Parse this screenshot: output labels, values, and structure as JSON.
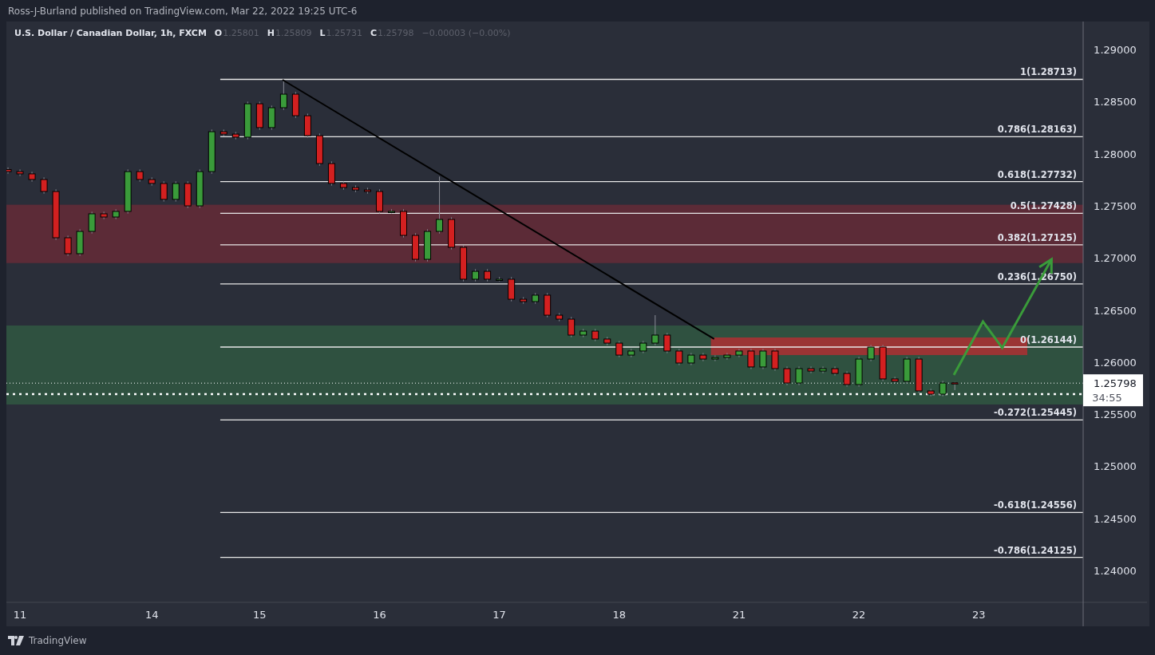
{
  "header": {
    "publisher_line": "Ross-J-Burland published on TradingView.com, Mar 22, 2022 19:25 UTC-6"
  },
  "legend": {
    "symbol": "U.S. Dollar / Canadian Dollar, 1h, FXCM",
    "ohlc": [
      {
        "key": "O",
        "value": "1.25801"
      },
      {
        "key": "H",
        "value": "1.25809"
      },
      {
        "key": "L",
        "value": "1.25731"
      },
      {
        "key": "C",
        "value": "1.25798"
      }
    ],
    "change": "−0.00003 (−0.00%)"
  },
  "chart": {
    "chart_data": {
      "type": "candlestick",
      "ylim": [
        1.23694,
        1.29268
      ],
      "categories": [
        null,
        "11",
        null,
        null,
        null,
        null,
        null,
        null,
        null,
        null,
        null,
        null,
        "14",
        null,
        null,
        null,
        null,
        null,
        null,
        null,
        null,
        "15",
        null,
        null,
        null,
        null,
        null,
        null,
        null,
        null,
        null,
        "16",
        null,
        null,
        null,
        null,
        null,
        null,
        null,
        null,
        null,
        "17",
        null,
        null,
        null,
        null,
        null,
        null,
        null,
        null,
        null,
        "18",
        null,
        null,
        null,
        null,
        null,
        null,
        null,
        null,
        null,
        "21",
        null,
        null,
        null,
        null,
        null,
        null,
        null,
        null,
        null,
        "22",
        null,
        null,
        null,
        null,
        null,
        null,
        null,
        null,
        null,
        "23",
        null,
        null,
        null,
        null,
        null,
        null,
        null,
        null,
        null
      ],
      "ohlc": [
        [
          1.27848,
          1.27868,
          1.27808,
          1.27828
        ],
        [
          1.27828,
          1.27848,
          1.27786,
          1.27806
        ],
        [
          1.27806,
          1.27826,
          1.27732,
          1.27752
        ],
        [
          1.27752,
          1.27772,
          1.27617,
          1.27637
        ],
        [
          1.27637,
          1.27657,
          1.27173,
          1.27193
        ],
        [
          1.27193,
          1.27213,
          1.2702,
          1.2704
        ],
        [
          1.2704,
          1.27274,
          1.2702,
          1.27254
        ],
        [
          1.27254,
          1.27443,
          1.27234,
          1.27423
        ],
        [
          1.27423,
          1.27443,
          1.27372,
          1.27392
        ],
        [
          1.27392,
          1.27466,
          1.27372,
          1.27446
        ],
        [
          1.27446,
          1.27848,
          1.27426,
          1.27828
        ],
        [
          1.27828,
          1.27848,
          1.27732,
          1.27752
        ],
        [
          1.27752,
          1.27772,
          1.27694,
          1.27714
        ],
        [
          1.27714,
          1.27734,
          1.27541,
          1.27561
        ],
        [
          1.27561,
          1.27734,
          1.27541,
          1.27714
        ],
        [
          1.27714,
          1.27734,
          1.27479,
          1.27499
        ],
        [
          1.27499,
          1.27848,
          1.27479,
          1.27828
        ],
        [
          1.27828,
          1.28231,
          1.27808,
          1.28211
        ],
        [
          1.28211,
          1.28231,
          1.28168,
          1.28188
        ],
        [
          1.28188,
          1.28208,
          1.28138,
          1.28158
        ],
        [
          1.28158,
          1.28499,
          1.28138,
          1.28479
        ],
        [
          1.28479,
          1.28499,
          1.2823,
          1.2825
        ],
        [
          1.2825,
          1.28461,
          1.2823,
          1.28441
        ],
        [
          1.28441,
          1.28713,
          1.28421,
          1.28571
        ],
        [
          1.28571,
          1.28591,
          1.28344,
          1.28364
        ],
        [
          1.28364,
          1.28384,
          1.28153,
          1.28173
        ],
        [
          1.28173,
          1.28193,
          1.27885,
          1.27905
        ],
        [
          1.27905,
          1.27925,
          1.27694,
          1.27714
        ],
        [
          1.27714,
          1.27734,
          1.27655,
          1.27675
        ],
        [
          1.27675,
          1.27695,
          1.27632,
          1.27652
        ],
        [
          1.27652,
          1.27672,
          1.27617,
          1.27637
        ],
        [
          1.27637,
          1.27657,
          1.27426,
          1.27446
        ],
        [
          1.27446,
          1.27466,
          1.27426,
          1.27446
        ],
        [
          1.27446,
          1.27466,
          1.27196,
          1.27216
        ],
        [
          1.27216,
          1.27236,
          1.26966,
          1.26986
        ],
        [
          1.26986,
          1.27274,
          1.26966,
          1.27254
        ],
        [
          1.27254,
          1.2778,
          1.27234,
          1.27369
        ],
        [
          1.27369,
          1.27389,
          1.27081,
          1.27101
        ],
        [
          1.27101,
          1.27121,
          1.26775,
          1.26795
        ],
        [
          1.26795,
          1.26891,
          1.26775,
          1.26871
        ],
        [
          1.26871,
          1.26891,
          1.26775,
          1.26795
        ],
        [
          1.26795,
          1.26815,
          1.26775,
          1.26795
        ],
        [
          1.26795,
          1.26815,
          1.26583,
          1.26603
        ],
        [
          1.26603,
          1.26623,
          1.2656,
          1.2658
        ],
        [
          1.2658,
          1.26662,
          1.2656,
          1.26642
        ],
        [
          1.26642,
          1.26662,
          1.2643,
          1.2645
        ],
        [
          1.2645,
          1.2647,
          1.26392,
          1.26412
        ],
        [
          1.26412,
          1.26432,
          1.26239,
          1.26259
        ],
        [
          1.26259,
          1.26317,
          1.26239,
          1.26297
        ],
        [
          1.26297,
          1.26317,
          1.26201,
          1.26221
        ],
        [
          1.26221,
          1.26241,
          1.26162,
          1.26182
        ],
        [
          1.26182,
          1.26202,
          1.26047,
          1.26067
        ],
        [
          1.26067,
          1.26126,
          1.26047,
          1.26106
        ],
        [
          1.26106,
          1.26202,
          1.26086,
          1.26182
        ],
        [
          1.26182,
          1.2645,
          1.26162,
          1.26259
        ],
        [
          1.26259,
          1.26279,
          1.26086,
          1.26106
        ],
        [
          1.26106,
          1.26126,
          1.25971,
          1.25991
        ],
        [
          1.25991,
          1.26087,
          1.25971,
          1.26067
        ],
        [
          1.26067,
          1.26087,
          1.26009,
          1.26029
        ],
        [
          1.26029,
          1.26064,
          1.26009,
          1.26044
        ],
        [
          1.26044,
          1.26087,
          1.26024,
          1.26067
        ],
        [
          1.26067,
          1.26126,
          1.26047,
          1.26106
        ],
        [
          1.26106,
          1.26126,
          1.25933,
          1.25953
        ],
        [
          1.25953,
          1.26126,
          1.25933,
          1.26106
        ],
        [
          1.26106,
          1.26126,
          1.25917,
          1.25937
        ],
        [
          1.25937,
          1.25957,
          1.25779,
          1.25799
        ],
        [
          1.25799,
          1.25957,
          1.25779,
          1.25937
        ],
        [
          1.25937,
          1.25957,
          1.25894,
          1.25914
        ],
        [
          1.25914,
          1.25957,
          1.25894,
          1.25937
        ],
        [
          1.25937,
          1.25957,
          1.25871,
          1.25891
        ],
        [
          1.25891,
          1.25911,
          1.25764,
          1.25784
        ],
        [
          1.25784,
          1.26049,
          1.25764,
          1.26029
        ],
        [
          1.26029,
          1.26164,
          1.26009,
          1.26144
        ],
        [
          1.26144,
          1.26164,
          1.25818,
          1.25838
        ],
        [
          1.25838,
          1.25858,
          1.25795,
          1.25815
        ],
        [
          1.25815,
          1.26049,
          1.25795,
          1.26029
        ],
        [
          1.26029,
          1.26049,
          1.25703,
          1.25723
        ],
        [
          1.25723,
          1.25743,
          1.25672,
          1.25692
        ],
        [
          1.25692,
          1.25819,
          1.25672,
          1.25799
        ],
        [
          1.25801,
          1.25809,
          1.25731,
          1.25798
        ],
        null,
        null,
        null,
        null,
        null,
        null,
        null,
        null,
        null,
        null,
        null
      ],
      "yticks": [
        {
          "value": 1.29,
          "label": "1.29000"
        },
        {
          "value": 1.285,
          "label": "1.28500"
        },
        {
          "value": 1.28,
          "label": "1.28000"
        },
        {
          "value": 1.275,
          "label": "1.27500"
        },
        {
          "value": 1.27,
          "label": "1.27000"
        },
        {
          "value": 1.265,
          "label": "1.26500"
        },
        {
          "value": 1.26,
          "label": "1.26000"
        },
        {
          "value": 1.255,
          "label": "1.25500"
        },
        {
          "value": 1.25,
          "label": "1.25000"
        },
        {
          "value": 1.245,
          "label": "1.24500"
        },
        {
          "value": 1.24,
          "label": "1.24000"
        }
      ],
      "ref_lines": [
        {
          "axis": "y",
          "value": 1.28713,
          "label": "1(1.28713)"
        },
        {
          "axis": "y",
          "value": 1.28163,
          "label": "0.786(1.28163)"
        },
        {
          "axis": "y",
          "value": 1.27732,
          "label": "0.618(1.27732)"
        },
        {
          "axis": "y",
          "value": 1.27428,
          "label": "0.5(1.27428)"
        },
        {
          "axis": "y",
          "value": 1.27125,
          "label": "0.382(1.27125)"
        },
        {
          "axis": "y",
          "value": 1.2675,
          "label": "0.236(1.26750)"
        },
        {
          "axis": "y",
          "value": 1.26144,
          "label": "0(1.26144)"
        },
        {
          "axis": "y",
          "value": 1.25445,
          "label": "-0.272(1.25445)"
        },
        {
          "axis": "y",
          "value": 1.24556,
          "label": "-0.618(1.24556)"
        },
        {
          "axis": "y",
          "value": 1.24125,
          "label": "-0.786(1.24125)"
        },
        {
          "axis": "y",
          "value": 1.25798
        },
        {
          "axis": "y",
          "value": 1.25692
        }
      ]
    },
    "price_tag": {
      "price": "1.25798",
      "countdown": "34:55"
    }
  },
  "footer": {
    "brand": "TradingView"
  }
}
